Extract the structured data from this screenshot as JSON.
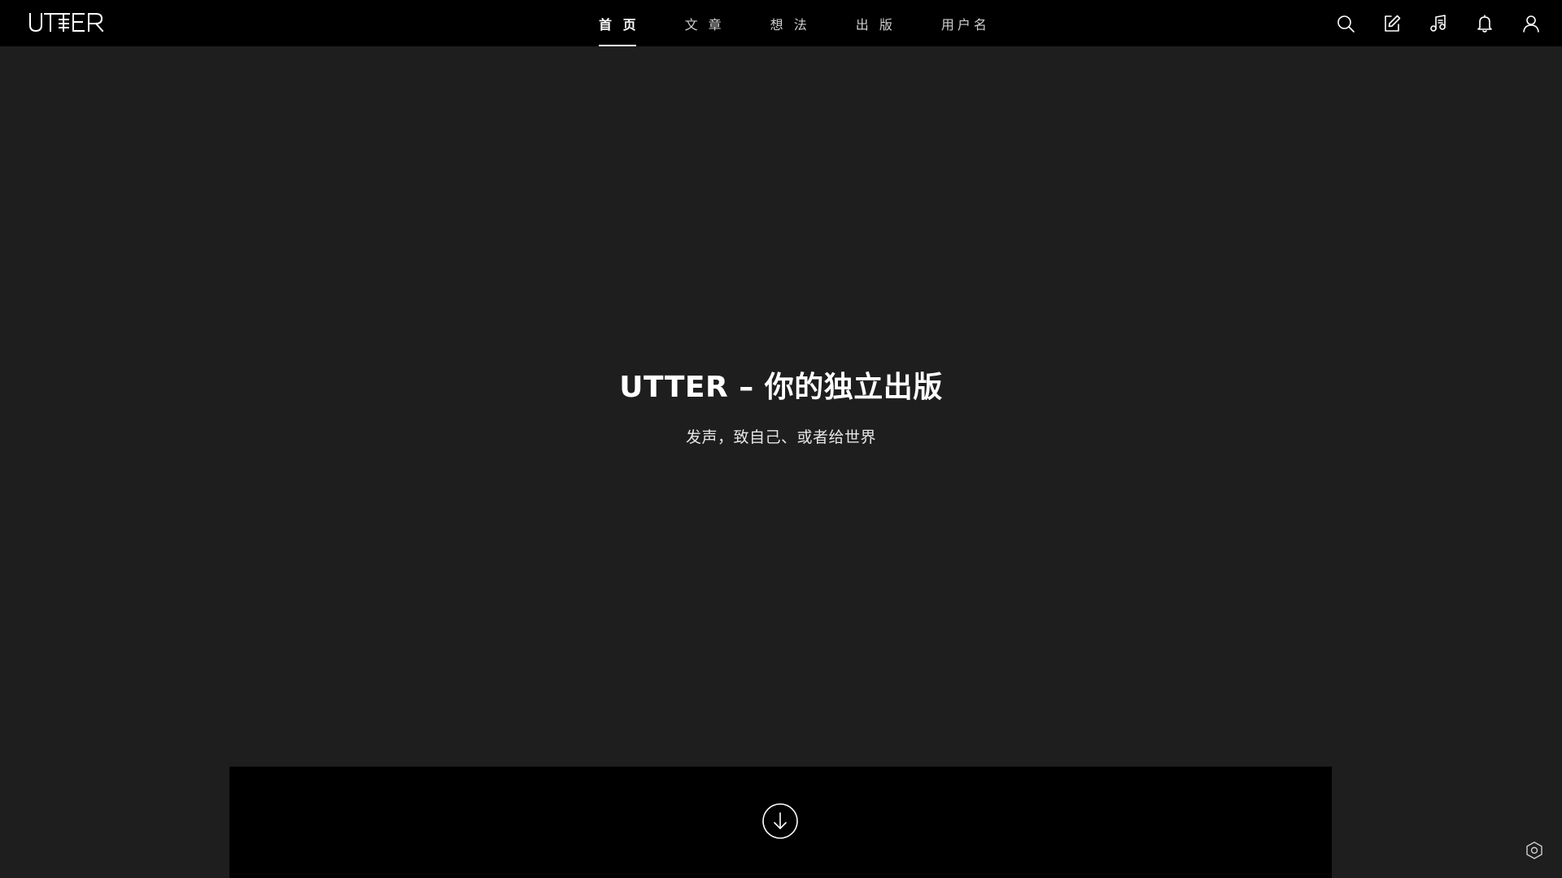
{
  "header": {
    "logo_text": "UTTER",
    "nav": [
      {
        "label": "首 页",
        "active": true
      },
      {
        "label": "文 章",
        "active": false
      },
      {
        "label": "想 法",
        "active": false
      },
      {
        "label": "出 版",
        "active": false
      },
      {
        "label": "用户名",
        "active": false
      }
    ],
    "icons": [
      "search-icon",
      "edit-icon",
      "music-icon",
      "bell-icon",
      "user-icon"
    ]
  },
  "hero": {
    "title": "UTTER – 你的独立出版",
    "subtitle": "发声，致自己、或者给世界"
  },
  "panel": {
    "scroll_icon": "arrow-down-circle-icon"
  },
  "floating": {
    "settings_icon": "hexagon-settings-icon"
  },
  "colors": {
    "background": "#1e1e1e",
    "topbar": "#000000",
    "panel": "#000000",
    "text": "#ffffff"
  }
}
